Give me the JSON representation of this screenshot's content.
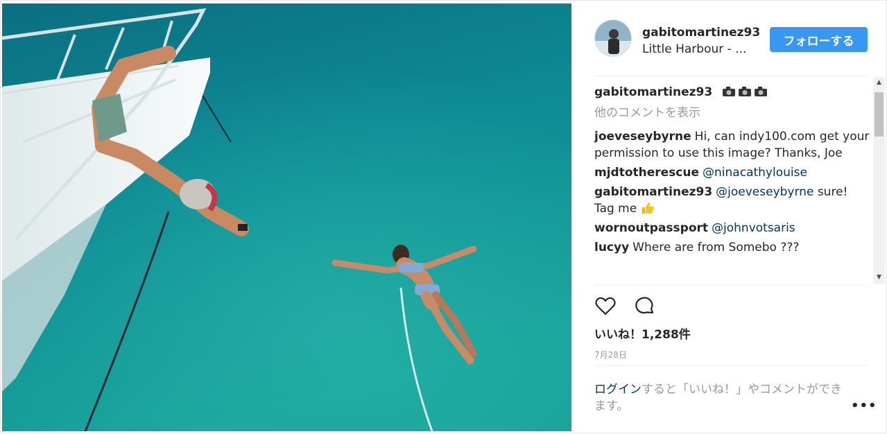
{
  "header": {
    "username": "gabitomartinez93",
    "location": "Little Harbour - ...",
    "follow_label": "フォローする"
  },
  "caption": {
    "username": "gabitomartinez93",
    "emoji": [
      "camera-icon",
      "camera-icon",
      "camera-icon"
    ]
  },
  "load_more_label": "他のコメントを表示",
  "comments": [
    {
      "user": "joeveseybyrne",
      "text": "Hi, can indy100.com get your permission to use this image? Thanks, Joe"
    },
    {
      "user": "mjdtotherescue",
      "mention": "@ninacathylouise"
    },
    {
      "user": "gabitomartinez93",
      "mention": "@joeveseybyrne",
      "text": "sure! Tag me",
      "emoji": "thumbs-up-icon"
    },
    {
      "user": "wornoutpassport",
      "mention": "@johnvotsaris"
    },
    {
      "user": "lucyy",
      "text": "Where are from Somebo ???"
    }
  ],
  "actions": {
    "like_icon": "heart-icon",
    "comment_icon": "comment-icon"
  },
  "likes": {
    "label": "いいね！",
    "count": "1,288件"
  },
  "date": "7月28日",
  "login": {
    "link": "ログイン",
    "text": "すると「いいね！」やコメントができます。"
  },
  "more_icon": "more-dots-icon",
  "colors": {
    "follow": "#3897f0",
    "link": "#003569",
    "muted": "#999999",
    "water": "#0e8a95"
  }
}
